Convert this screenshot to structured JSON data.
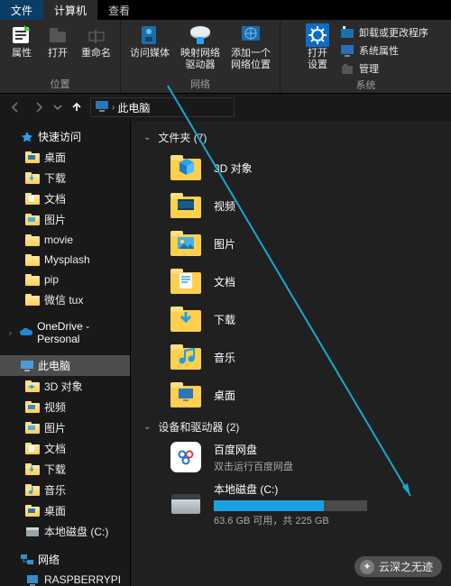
{
  "tabs": {
    "file": "文件",
    "computer": "计算机",
    "view": "查看"
  },
  "ribbon": {
    "location": {
      "title": "位置",
      "props": "属性",
      "open": "打开",
      "rename": "重命名"
    },
    "network": {
      "title": "网络",
      "media": "访问媒体",
      "map_drive": "映射网络\n驱动器",
      "add_loc": "添加一个\n网络位置"
    },
    "system": {
      "title": "系统",
      "open_settings": "打开\n设置",
      "uninstall": "卸载或更改程序",
      "sysprops": "系统属性"
    },
    "manage": "管理"
  },
  "breadcrumb": {
    "node": "此电脑"
  },
  "tree": {
    "quick": {
      "label": "快速访问",
      "items": [
        "桌面",
        "下载",
        "文档",
        "图片",
        "movie",
        "Mysplash",
        "pip",
        "微信 tux"
      ]
    },
    "onedrive": "OneDrive - Personal",
    "pc": {
      "label": "此电脑",
      "items": [
        "3D 对象",
        "视频",
        "图片",
        "文档",
        "下载",
        "音乐",
        "桌面",
        "本地磁盘 (C:)"
      ]
    },
    "network": {
      "label": "网络",
      "items": [
        "RASPBERRYPI"
      ]
    }
  },
  "content": {
    "folders_header": "文件夹 (7)",
    "folders": [
      "3D 对象",
      "视频",
      "图片",
      "文档",
      "下载",
      "音乐",
      "桌面"
    ],
    "drives_header": "设备和驱动器 (2)",
    "app": {
      "name": "百度网盘",
      "sub": "双击运行百度网盘"
    },
    "disk": {
      "name": "本地磁盘 (C:)",
      "usage": "63.6 GB 可用，共 225 GB",
      "fill_pct": 72
    }
  },
  "watermark": "云深之无迹"
}
